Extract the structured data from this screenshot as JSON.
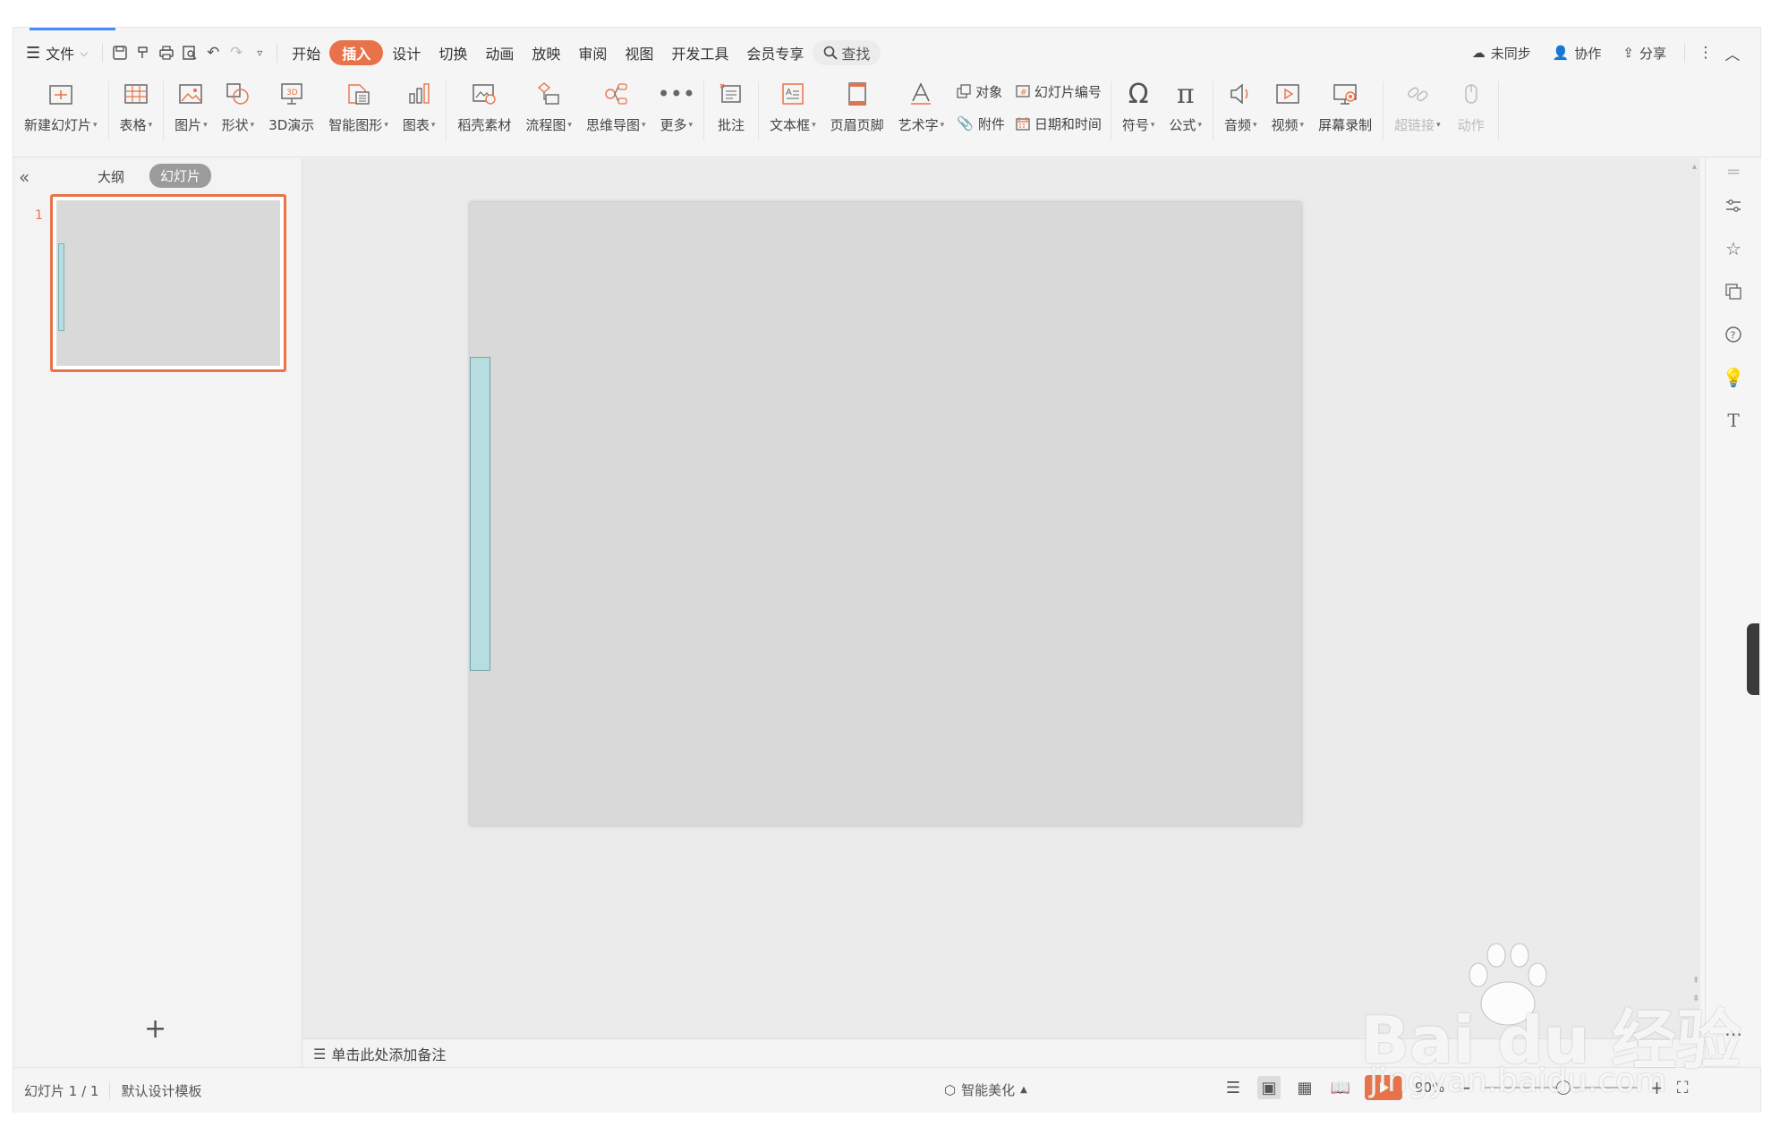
{
  "menubar": {
    "file": "文件",
    "tabs": [
      "开始",
      "插入",
      "设计",
      "切换",
      "动画",
      "放映",
      "审阅",
      "视图",
      "开发工具",
      "会员专享"
    ],
    "active_tab": "插入",
    "search": "查找",
    "sync": "未同步",
    "collab": "协作",
    "share": "分享"
  },
  "ribbon": {
    "new_slide": "新建幻灯片",
    "table": "表格",
    "picture": "图片",
    "shape": "形状",
    "demo3d": "3D演示",
    "smartart": "智能图形",
    "chart": "图表",
    "docer": "稻壳素材",
    "flowchart": "流程图",
    "mindmap": "思维导图",
    "more": "更多",
    "comment": "批注",
    "textbox": "文本框",
    "header_footer": "页眉页脚",
    "wordart": "艺术字",
    "object": "对象",
    "attachment": "附件",
    "slide_number": "幻灯片编号",
    "date_time": "日期和时间",
    "symbol": "符号",
    "equation": "公式",
    "audio": "音频",
    "video": "视频",
    "screen_record": "屏幕录制",
    "hyperlink": "超链接",
    "action": "动作"
  },
  "leftpane": {
    "tab_outline": "大纲",
    "tab_slides": "幻灯片",
    "thumb_number": "1",
    "add": "+"
  },
  "notes": {
    "placeholder": "单击此处添加备注"
  },
  "status": {
    "slide_counter": "幻灯片 1 / 1",
    "template": "默认设计模板",
    "beautify": "智能美化",
    "zoom": "90%"
  },
  "watermark": {
    "brand": "Bai du 经验",
    "url": "jingyan.baidu.com"
  },
  "colors": {
    "accent": "#e8734a",
    "slide_bg": "#d9d9d9",
    "shape_fill": "#b7dde0",
    "shape_border": "#6fa4a8"
  }
}
